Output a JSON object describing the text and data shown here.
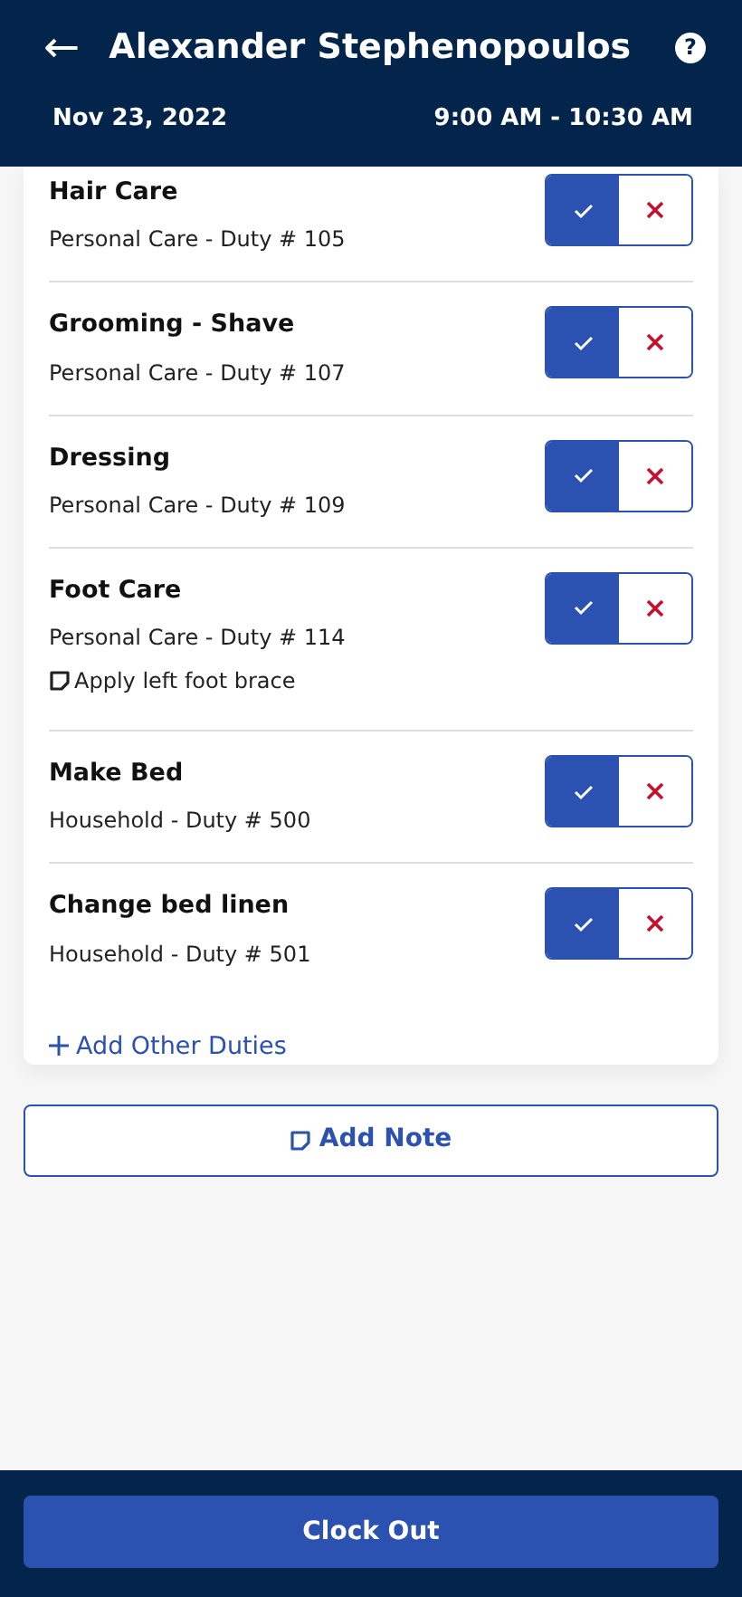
{
  "header": {
    "back": "←",
    "title": "Alexander Stephenopoulos",
    "help": "?",
    "date": "Nov 23, 2022",
    "time": "9:00 AM - 10:30 AM"
  },
  "duties": [
    {
      "name": "Hair Care",
      "detail": "Personal Care - Duty # 105",
      "completed": true
    },
    {
      "name": "Grooming - Shave",
      "detail": "Personal Care - Duty # 107",
      "completed": true
    },
    {
      "name": "Dressing",
      "detail": "Personal Care - Duty # 109",
      "completed": true
    },
    {
      "name": "Foot Care",
      "detail": "Personal Care - Duty # 114",
      "note": "Apply left foot brace",
      "completed": true
    },
    {
      "name": "Make Bed",
      "detail": "Household - Duty # 500",
      "completed": true
    },
    {
      "name": "Change bed linen",
      "detail": "Household - Duty # 501",
      "completed": true
    }
  ],
  "add_duties": "Add Other Duties",
  "add_note": "Add Note",
  "clock_out": "Clock Out"
}
